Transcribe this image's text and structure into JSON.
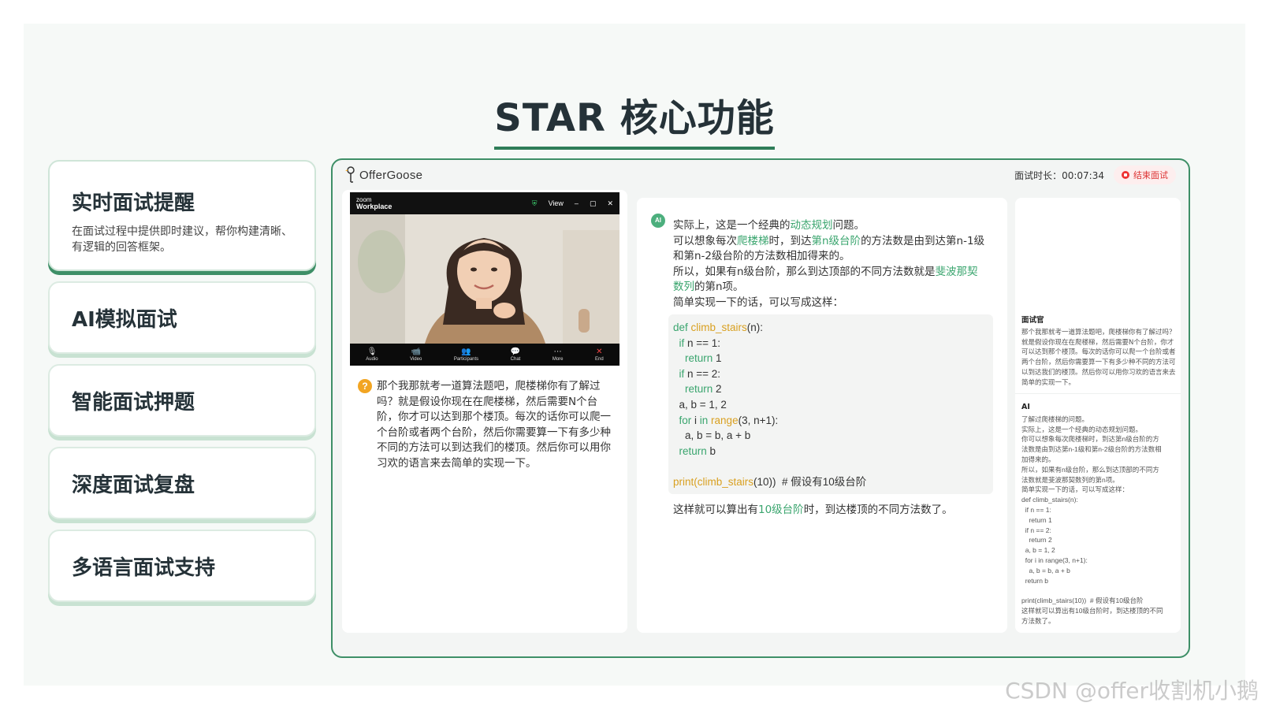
{
  "slide": {
    "title": "STAR 核心功能"
  },
  "features": [
    {
      "title": "实时面试提醒",
      "desc": "在面试过程中提供即时建议，帮你构建清晰、有逻辑的回答框架。"
    },
    {
      "title": "AI模拟面试"
    },
    {
      "title": "智能面试押题"
    },
    {
      "title": "深度面试复盘"
    },
    {
      "title": "多语言面试支持"
    }
  ],
  "app": {
    "logo": "OfferGoose",
    "timer_label": "面试时长：",
    "timer_value": "00:07:34",
    "end_button": "结束面试",
    "zoom": {
      "brand_top": "zoom",
      "brand_bottom": "Workplace",
      "view_label": "View",
      "controls": [
        {
          "icon": "🎙",
          "label": "Audio"
        },
        {
          "icon": "📹",
          "label": "Video"
        },
        {
          "icon": "👥",
          "label": "Participants"
        },
        {
          "icon": "💬",
          "label": "Chat"
        },
        {
          "icon": "⋯",
          "label": "More"
        },
        {
          "icon": "✕",
          "label": "End"
        }
      ]
    },
    "question": {
      "icon": "?",
      "text": "那个我那就考一道算法题吧，爬楼梯你有了解过吗？就是假设你现在在爬楼梯，然后需要N个台阶，你才可以达到那个楼顶。每次的话你可以爬一个台阶或者两个台阶，然后你需要算一下有多少种不同的方法可以到达我们的楼顶。然后你可以用你习欢的语言来去简单的实现一下。"
    },
    "answer": {
      "badge": "AI",
      "p1_a": "实际上，这是一个经典的",
      "p1_hl": "动态规划",
      "p1_b": "问题。",
      "p2_a": "可以想象每次",
      "p2_hl1": "爬楼梯",
      "p2_b": "时，到达",
      "p2_hl2": "第n级台阶",
      "p2_c": "的方法数是由到达第n-1级和第n-2级台阶的方法数相加得来的。",
      "p3_a": "所以，如果有n级台阶，那么到达顶部的不同方法数就是",
      "p3_hl": "斐波那契数列",
      "p3_b": "的第n项。",
      "p4": "简单实现一下的话，可以写成这样：",
      "code": {
        "l1_kw": "def ",
        "l1_fn": "climb_stairs",
        "l1_rest": "(n):",
        "l2_kw": "  if",
        "l2_rest": " n == 1:",
        "l3_kw": "    return",
        "l3_rest": " 1",
        "l4_kw": "  if",
        "l4_rest": " n == 2:",
        "l5_kw": "    return",
        "l5_rest": " 2",
        "l6": "  a, b = 1, 2",
        "l7_kw": "  for",
        "l7_mid": " i ",
        "l7_kw2": "in",
        "l7_fn": " range",
        "l7_rest": "(3, n+1):",
        "l8": "    a, b = b, a + b",
        "l9_kw": "  return",
        "l9_rest": " b",
        "l10_kw": "print",
        "l10_p": "(",
        "l10_fn": "climb_stairs",
        "l10_rest": "(10))  # 假设有10级台阶"
      },
      "end_a": "这样就可以算出有",
      "end_hl": "10级台阶",
      "end_b": "时，到达楼顶的不同方法数了。"
    },
    "transcript": {
      "interviewer_label": "面试官",
      "interviewer_text": "那个我那就考一道算法题吧，爬楼梯你有了解过吗？就是假设你现在在爬楼梯，然后需要N个台阶，你才可以达到那个楼顶。每次的话你可以爬一个台阶或者两个台阶，然后你需要算一下有多少种不同的方法可以到达我们的楼顶。然后你可以用你习欢的语言来去简单的实现一下。",
      "ai_label": "AI",
      "ai_text": "了解过爬楼梯的问题。\n实际上，这是一个经典的动态规划问题。\n你可以想象每次爬楼梯时，到达第n级台阶的方\n法数是由到达第n-1级和第n-2级台阶的方法数相\n加得来的。\n所以，如果有n级台阶，那么到达顶部的不同方\n法数就是斐波那契数列的第n项。\n简单实现一下的话，可以写成这样：\ndef climb_stairs(n):\n  if n == 1:\n    return 1\n  if n == 2:\n    return 2\n  a, b = 1, 2\n  for i in range(3, n+1):\n    a, b = b, a + b\n  return b\n\nprint(climb_stairs(10))  # 假设有10级台阶\n这样就可以算出有10级台阶时，到达楼顶的不同\n方法数了。"
    }
  },
  "watermark": "CSDN @offer收割机小鹅",
  "colors": {
    "accent": "#3e8f67",
    "highlight": "#3aa56e",
    "code_function": "#d9a020",
    "end_red": "#e33333"
  }
}
